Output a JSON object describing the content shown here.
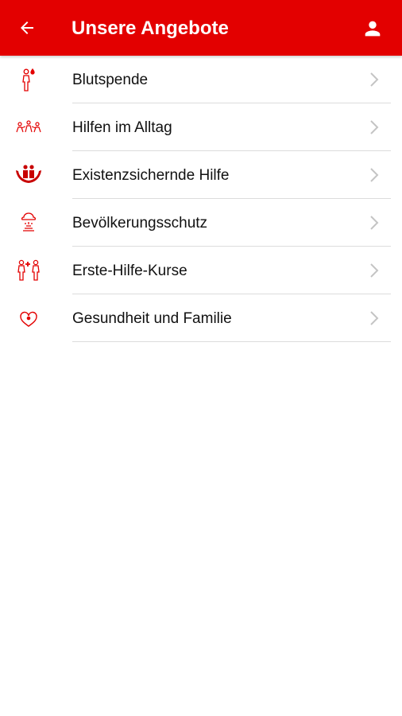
{
  "header": {
    "title": "Unsere Angebote",
    "back_icon": "arrow-left-icon",
    "profile_icon": "person-icon",
    "background": "#e30000",
    "text_color": "#ffffff"
  },
  "menu": {
    "accent_color": "#e30000",
    "items": [
      {
        "label": "Blutspende",
        "icon": "blood-donor-icon"
      },
      {
        "label": "Hilfen im Alltag",
        "icon": "helping-people-icon"
      },
      {
        "label": "Existenzsichernde Hilfe",
        "icon": "hands-holding-family-icon"
      },
      {
        "label": "Bevölkerungsschutz",
        "icon": "disaster-protection-icon"
      },
      {
        "label": "Erste-Hilfe-Kurse",
        "icon": "first-aid-people-icon"
      },
      {
        "label": "Gesundheit und Familie",
        "icon": "heart-icon"
      }
    ]
  }
}
